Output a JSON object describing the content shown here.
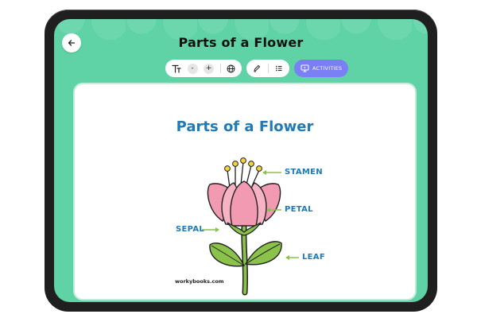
{
  "header": {
    "title": "Parts of a Flower"
  },
  "toolbar": {
    "text_size_minus": "-",
    "text_size_plus": "+",
    "activities_label": "ACTIVITIES"
  },
  "worksheet": {
    "title": "Parts of a Flower",
    "labels": {
      "stamen": "STAMEN",
      "petal": "PETAL",
      "sepal": "SEPAL",
      "leaf": "LEAF"
    },
    "credit": "workybooks.com"
  },
  "colors": {
    "screen_bg": "#5fd3a6",
    "accent_purple": "#7b7ff5",
    "label_blue": "#1f7ab8",
    "petal_pink": "#f29ab2",
    "leaf_green": "#8bc24a",
    "stamen_yellow": "#f4d23d"
  },
  "icons": {
    "back": "arrow-left-icon",
    "text": "text-format-icon",
    "globe": "globe-icon",
    "pencil": "pencil-icon",
    "list": "list-icon",
    "activities": "presentation-icon"
  }
}
